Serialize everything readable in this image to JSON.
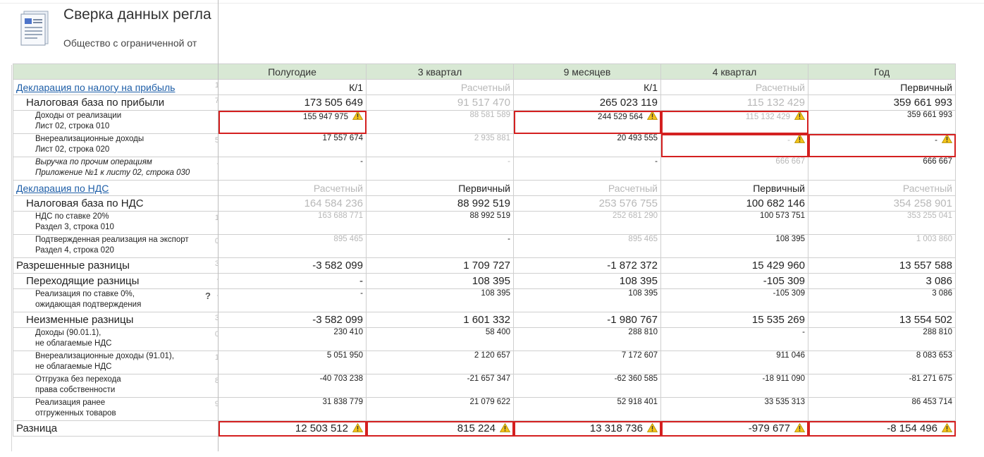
{
  "header": {
    "title": "Сверка данных регла",
    "organization": "Общество с ограниченной от",
    "icon": "document-icon"
  },
  "columns": [
    "Полугодие",
    "3 квартал",
    "9 месяцев",
    "4 квартал",
    "Год"
  ],
  "colors": {
    "header_bg": "#d8e8d4",
    "error_border": "#d42020",
    "warning": "#f2c318",
    "link": "#1f5fa8",
    "muted": "#b8b8b8"
  },
  "rows": [
    {
      "label": [
        "Декларация по налогу на прибыль"
      ],
      "kind": "link",
      "indent": 0,
      "size": "h1",
      "cut": "1",
      "cells": [
        {
          "v": "К/1"
        },
        {
          "v": "Расчетный",
          "muted": true
        },
        {
          "v": "К/1"
        },
        {
          "v": "Расчетный",
          "muted": true
        },
        {
          "v": "Первичный"
        }
      ]
    },
    {
      "label": [
        "Налоговая база по прибыли"
      ],
      "kind": "text",
      "indent": 1,
      "size": "h2",
      "cut": "7",
      "cells": [
        {
          "v": "173 505 649"
        },
        {
          "v": "91 517 470",
          "muted": true
        },
        {
          "v": "265 023 119"
        },
        {
          "v": "115 132 429",
          "muted": true
        },
        {
          "v": "359 661 993"
        }
      ]
    },
    {
      "label": [
        "Доходы от реализации",
        "Лист 02, строка 010"
      ],
      "kind": "text",
      "indent": 2,
      "size": "sm",
      "cut": "",
      "cells": [
        {
          "v": "155 947 975",
          "err": true,
          "warn": true
        },
        {
          "v": "88 581 589",
          "muted": true
        },
        {
          "v": "244 529 564",
          "err": true,
          "warn": true
        },
        {
          "v": "115 132 429",
          "muted": true,
          "err": true,
          "warn": true
        },
        {
          "v": "359 661 993"
        }
      ]
    },
    {
      "label": [
        "Внереализационные доходы",
        "Лист 02, строка 020"
      ],
      "kind": "text",
      "indent": 2,
      "size": "sm",
      "cut": "5",
      "cells": [
        {
          "v": "17 557 674"
        },
        {
          "v": "2 935 881",
          "muted": true
        },
        {
          "v": "20 493 555"
        },
        {
          "v": "-",
          "muted": true,
          "err": true,
          "warn": true
        },
        {
          "v": "-",
          "err": true,
          "warn": true
        }
      ]
    },
    {
      "label": [
        "Выручка по прочим операциям",
        "Приложение №1 к листу 02, строка 030"
      ],
      "kind": "italic",
      "indent": 2,
      "size": "sm",
      "cut": "-",
      "cells": [
        {
          "v": "-"
        },
        {
          "v": "-",
          "muted": true
        },
        {
          "v": "-"
        },
        {
          "v": "666 667",
          "muted": true
        },
        {
          "v": "666 667"
        }
      ]
    },
    {
      "label": [
        "Декларация по НДС"
      ],
      "kind": "link",
      "indent": 0,
      "size": "h1",
      "cut": "l",
      "cells": [
        {
          "v": "Расчетный",
          "muted": true
        },
        {
          "v": "Первичный"
        },
        {
          "v": "Расчетный",
          "muted": true
        },
        {
          "v": "Первичный"
        },
        {
          "v": "Расчетный",
          "muted": true
        }
      ]
    },
    {
      "label": [
        "Налоговая база по НДС"
      ],
      "kind": "text",
      "indent": 1,
      "size": "h2",
      "cut": "l",
      "cells": [
        {
          "v": "164 584 236",
          "muted": true
        },
        {
          "v": "88 992 519"
        },
        {
          "v": "253 576 755",
          "muted": true
        },
        {
          "v": "100 682 146"
        },
        {
          "v": "354 258 901",
          "muted": true
        }
      ]
    },
    {
      "label": [
        "НДС по ставке 20%",
        "Раздел 3, строка 010"
      ],
      "kind": "text",
      "indent": 2,
      "size": "sm",
      "cut": "1",
      "cells": [
        {
          "v": "163 688 771",
          "muted": true
        },
        {
          "v": "88 992 519"
        },
        {
          "v": "252 681 290",
          "muted": true
        },
        {
          "v": "100 573 751"
        },
        {
          "v": "353 255 041",
          "muted": true
        }
      ]
    },
    {
      "label": [
        "Подтвержденная реализация на экспорт",
        "Раздел 4, строка 020"
      ],
      "kind": "text",
      "indent": 2,
      "size": "sm",
      "cut": "0",
      "cells": [
        {
          "v": "895 465",
          "muted": true
        },
        {
          "v": "-"
        },
        {
          "v": "895 465",
          "muted": true
        },
        {
          "v": "108 395"
        },
        {
          "v": "1 003 860",
          "muted": true
        }
      ]
    },
    {
      "label": [
        "Разрешенные разницы"
      ],
      "kind": "text",
      "indent": 0,
      "size": "h2",
      "cut": "3",
      "cells": [
        {
          "v": "-3 582 099"
        },
        {
          "v": "1 709 727"
        },
        {
          "v": "-1 872 372"
        },
        {
          "v": "15 429 960"
        },
        {
          "v": "13 557 588"
        }
      ]
    },
    {
      "label": [
        "Переходящие разницы"
      ],
      "kind": "text",
      "indent": 1,
      "size": "h2",
      "cut": "-",
      "cells": [
        {
          "v": "-"
        },
        {
          "v": "108 395"
        },
        {
          "v": "108 395"
        },
        {
          "v": "-105 309"
        },
        {
          "v": "3 086"
        }
      ]
    },
    {
      "label": [
        "Реализация по ставке 0%,",
        "ожидающая подтверждения"
      ],
      "kind": "text",
      "indent": 2,
      "size": "sm",
      "cut": "-",
      "question": "?",
      "cells": [
        {
          "v": "-"
        },
        {
          "v": "108 395"
        },
        {
          "v": "108 395"
        },
        {
          "v": "-105 309"
        },
        {
          "v": "3 086"
        }
      ]
    },
    {
      "label": [
        "Неизменные разницы"
      ],
      "kind": "text",
      "indent": 1,
      "size": "h2",
      "cut": "3",
      "cells": [
        {
          "v": "-3 582 099"
        },
        {
          "v": "1 601 332"
        },
        {
          "v": "-1 980 767"
        },
        {
          "v": "15 535 269"
        },
        {
          "v": "13 554 502"
        }
      ]
    },
    {
      "label": [
        "Доходы (90.01.1),",
        "не облагаемые НДС"
      ],
      "kind": "text",
      "indent": 2,
      "size": "sm",
      "cut": "0",
      "cells": [
        {
          "v": "230 410"
        },
        {
          "v": "58 400"
        },
        {
          "v": "288 810"
        },
        {
          "v": "-"
        },
        {
          "v": "288 810"
        }
      ]
    },
    {
      "label": [
        "Внереализационные доходы (91.01),",
        "не облагаемые НДС"
      ],
      "kind": "text",
      "indent": 2,
      "size": "sm",
      "cut": "1",
      "cells": [
        {
          "v": "5 051 950"
        },
        {
          "v": "2 120 657"
        },
        {
          "v": "7 172 607"
        },
        {
          "v": "911 046"
        },
        {
          "v": "8 083 653"
        }
      ]
    },
    {
      "label": [
        "Отгрузка без перехода",
        "права собственности"
      ],
      "kind": "text",
      "indent": 2,
      "size": "sm",
      "cut": "8",
      "cells": [
        {
          "v": "-40 703 238"
        },
        {
          "v": "-21 657 347"
        },
        {
          "v": "-62 360 585"
        },
        {
          "v": "-18 911 090"
        },
        {
          "v": "-81 271 675"
        }
      ]
    },
    {
      "label": [
        "Реализация ранее",
        "отгруженных товаров"
      ],
      "kind": "text",
      "indent": 2,
      "size": "sm",
      "cut": "9",
      "cells": [
        {
          "v": "31 838 779"
        },
        {
          "v": "21 079 622"
        },
        {
          "v": "52 918 401"
        },
        {
          "v": "33 535 313"
        },
        {
          "v": "86 453 714"
        }
      ]
    },
    {
      "label": [
        "Разница"
      ],
      "kind": "text",
      "indent": 0,
      "size": "big",
      "cut": "",
      "cells": [
        {
          "v": "12 503 512",
          "err": true,
          "warn": true
        },
        {
          "v": "815 224",
          "err": true,
          "warn": true
        },
        {
          "v": "13 318 736",
          "err": true,
          "warn": true
        },
        {
          "v": "-979 677",
          "err": true,
          "warn": true
        },
        {
          "v": "-8 154 496",
          "err": true,
          "warn": true
        }
      ]
    }
  ]
}
